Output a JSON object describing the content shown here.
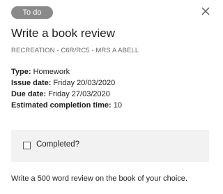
{
  "status_badge": "To do",
  "title": "Write a book review",
  "subtitle": "RECREATION - C6R/RC5 - MRS A ABELL",
  "details": [
    {
      "key": "Type:",
      "value": " Homework"
    },
    {
      "key": "Issue date:",
      "value": " Friday 20/03/2020"
    },
    {
      "key": "Due date:",
      "value": " Friday 27/03/2020"
    },
    {
      "key": "Estimated completion time:",
      "value": " 10"
    }
  ],
  "completed_label": "Completed?",
  "description": "Write a 500 word review on the book of your choice.",
  "icons": {
    "close": "close-icon",
    "checkbox": "checkbox-unchecked"
  },
  "colors": {
    "badge_bg": "#8a8a8a",
    "box_bg": "#f2f2f2"
  }
}
